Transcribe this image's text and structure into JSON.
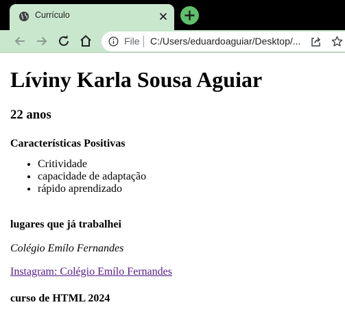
{
  "browser": {
    "tab_title": "Currículo",
    "omnibox": {
      "scheme": "File",
      "url": "C:/Users/eduardoaguiar/Desktop/..."
    },
    "icons": {
      "favicon": "globe-icon",
      "tab_close": "close-icon",
      "new_tab": "plus-icon",
      "back": "back-arrow-icon",
      "forward": "forward-arrow-icon",
      "reload": "reload-icon",
      "home": "home-icon",
      "site_info": "info-icon",
      "share": "share-icon",
      "bookmark": "star-icon"
    },
    "colors": {
      "chrome": "#c9e7cd",
      "new_tab_button": "#5ec06b",
      "visited_link": "#551a8b"
    }
  },
  "page": {
    "name": "Líviny Karla Sousa Aguiar",
    "age": "22 anos",
    "traits_heading": "Características Positivas",
    "traits": [
      "Critividade",
      "capacidade de adaptação",
      "rápido aprendizado"
    ],
    "work_heading": "lugares que já trabalhei",
    "workplace": "Colégio Emílo Fernandes",
    "instagram_link": "Instagram: Colégio Emílo Fernandes",
    "course": "curso de HTML 2024"
  }
}
